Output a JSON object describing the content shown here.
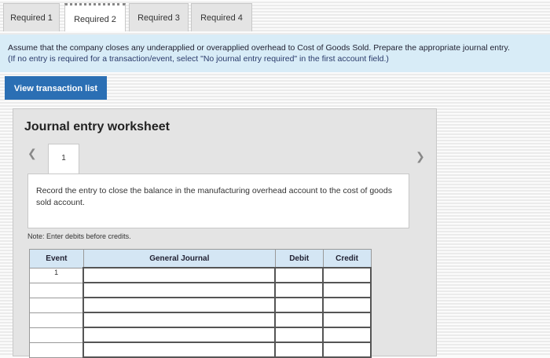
{
  "tabs": [
    {
      "label": "Required 1"
    },
    {
      "label": "Required 2"
    },
    {
      "label": "Required 3"
    },
    {
      "label": "Required 4"
    }
  ],
  "instructions": {
    "line1": "Assume that the company closes any underapplied or overapplied overhead to Cost of Goods Sold. Prepare the appropriate journal entry.",
    "line2": "(If no entry is required for a transaction/event, select \"No journal entry required\" in the first account field.)"
  },
  "view_button": "View transaction list",
  "worksheet": {
    "title": "Journal entry worksheet",
    "entry_number": "1",
    "description": "Record the entry to close the balance in the manufacturing overhead account to the cost of goods sold account.",
    "note": "Note: Enter debits before credits.",
    "columns": {
      "event": "Event",
      "general_journal": "General Journal",
      "debit": "Debit",
      "credit": "Credit"
    },
    "rows": [
      {
        "event": "1"
      },
      {
        "event": ""
      },
      {
        "event": ""
      },
      {
        "event": ""
      },
      {
        "event": ""
      },
      {
        "event": ""
      }
    ]
  },
  "icons": {
    "prev": "chevron-left-icon",
    "next": "chevron-right-icon"
  }
}
